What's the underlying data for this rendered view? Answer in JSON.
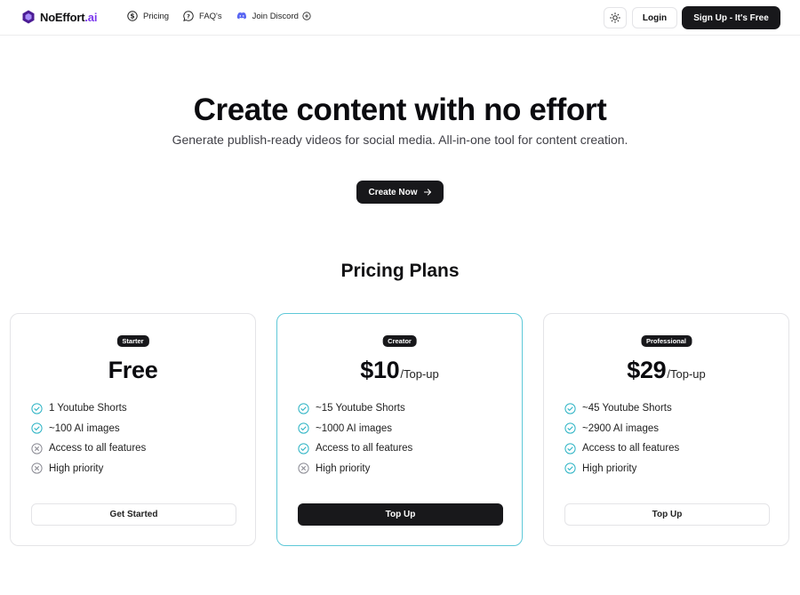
{
  "nav": {
    "brand_name": "NoEffort",
    "brand_suffix": ".ai",
    "links": [
      {
        "label": "Pricing",
        "icon": "dollar-circle-icon"
      },
      {
        "label": "FAQ's",
        "icon": "question-bubble-icon"
      },
      {
        "label": "Join Discord",
        "icon": "discord-icon"
      }
    ],
    "login_label": "Login",
    "signup_label": "Sign Up - It's Free"
  },
  "hero": {
    "title": "Create content with no effort",
    "subtitle": "Generate publish-ready videos for social media. All-in-one tool for content creation.",
    "cta_label": "Create Now"
  },
  "pricing": {
    "title": "Pricing Plans",
    "plans": [
      {
        "badge": "Starter",
        "price": "Free",
        "suffix": "",
        "features": [
          {
            "text": "1 Youtube Shorts",
            "included": true
          },
          {
            "text": "~100 AI images",
            "included": true
          },
          {
            "text": "Access to all features",
            "included": false
          },
          {
            "text": "High priority",
            "included": false
          }
        ],
        "button_label": "Get Started"
      },
      {
        "badge": "Creator",
        "price": "$10",
        "suffix": "/Top-up",
        "features": [
          {
            "text": "~15 Youtube Shorts",
            "included": true
          },
          {
            "text": "~1000 AI images",
            "included": true
          },
          {
            "text": "Access to all features",
            "included": true
          },
          {
            "text": "High priority",
            "included": false
          }
        ],
        "button_label": "Top Up"
      },
      {
        "badge": "Professional",
        "price": "$29",
        "suffix": "/Top-up",
        "features": [
          {
            "text": "~45 Youtube Shorts",
            "included": true
          },
          {
            "text": "~2900 AI images",
            "included": true
          },
          {
            "text": "Access to all features",
            "included": true
          },
          {
            "text": "High priority",
            "included": true
          }
        ],
        "button_label": "Top Up"
      }
    ]
  },
  "colors": {
    "brand_accent": "#7c3aed",
    "check": "#2bb3c4",
    "cross": "#8a8a93",
    "featured_border": "#5ec8d8",
    "dark_button": "#18181b"
  }
}
